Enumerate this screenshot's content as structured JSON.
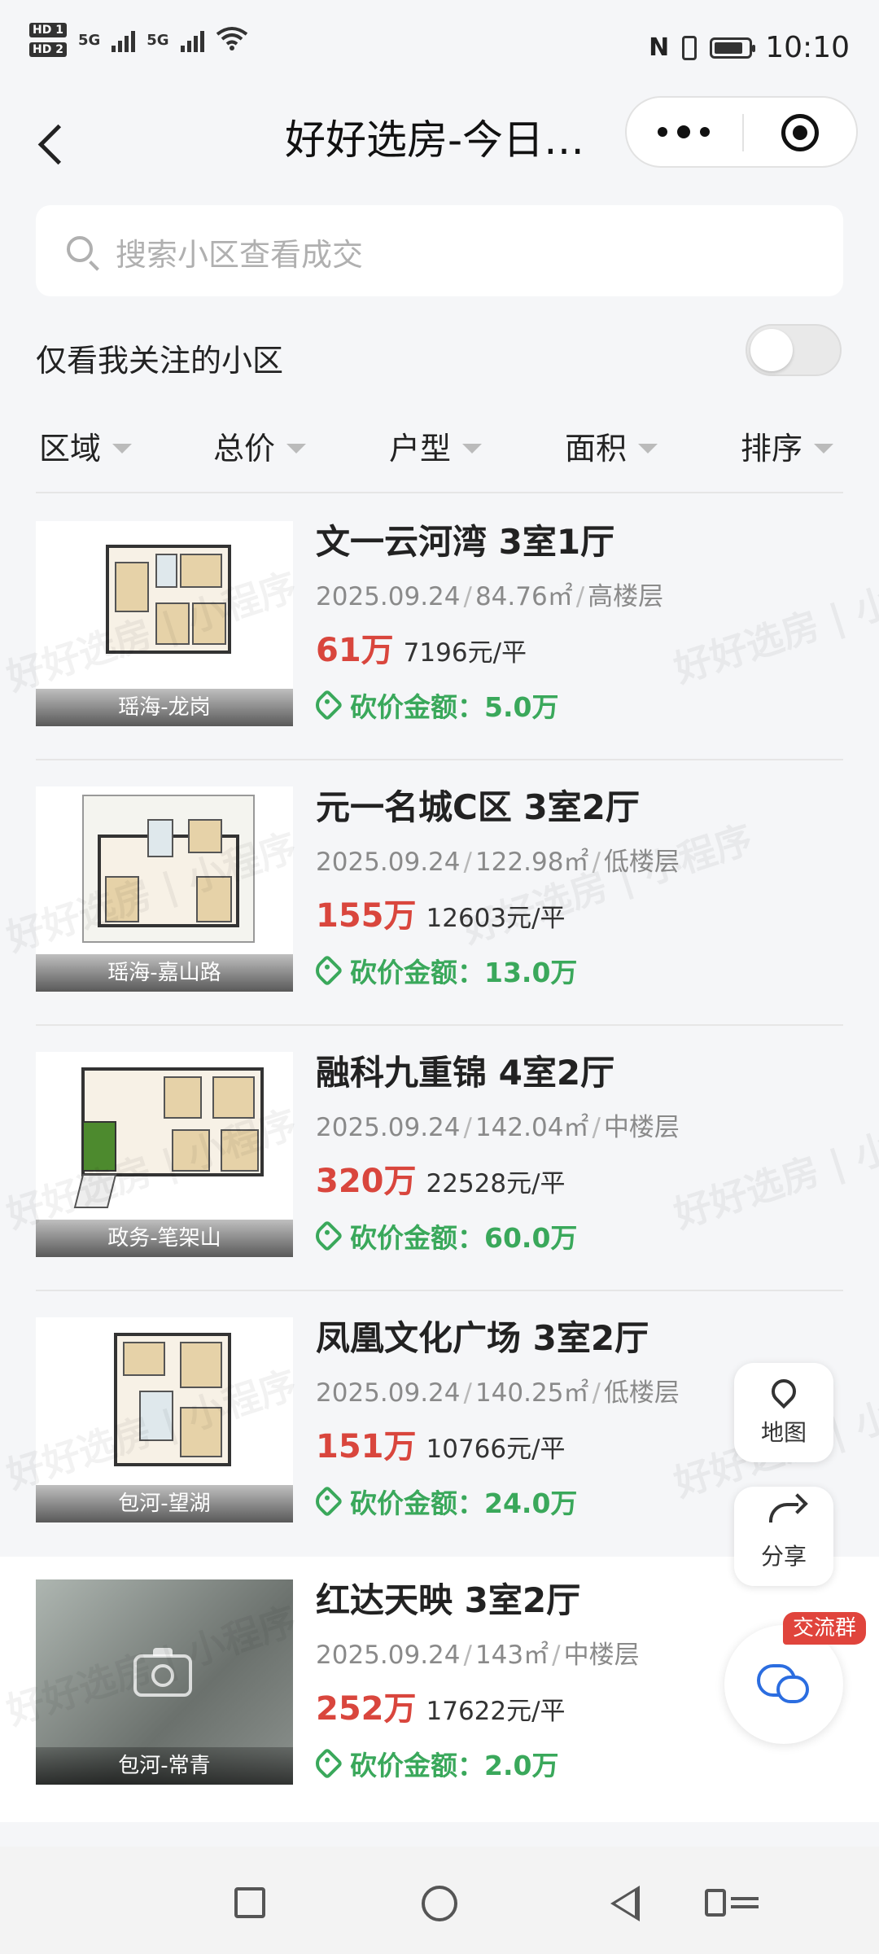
{
  "status_bar": {
    "sim1": "HD 1",
    "sim2": "HD 2",
    "net1": "5G",
    "net2": "5G",
    "wifi": "6",
    "time": "10:10"
  },
  "nav": {
    "title": "好好选房-今日…",
    "back_icon": "chevron-left-icon",
    "more_icon": "more-dots-icon",
    "close_icon": "target-circle-icon"
  },
  "search": {
    "placeholder": "搜索小区查看成交"
  },
  "follow_toggle": {
    "label": "仅看我关注的小区",
    "on": false
  },
  "filters": [
    {
      "label": "区域"
    },
    {
      "label": "总价"
    },
    {
      "label": "户型"
    },
    {
      "label": "面积"
    },
    {
      "label": "排序"
    }
  ],
  "listings": [
    {
      "title": "文一云河湾 3室1厅",
      "date": "2025.09.24",
      "area": "84.76㎡",
      "floor": "高楼层",
      "price": "61万",
      "unit_price": "7196元/平",
      "cut": "砍价金额：5.0万",
      "location": "瑶海-龙岗"
    },
    {
      "title": "元一名城C区 3室2厅",
      "date": "2025.09.24",
      "area": "122.98㎡",
      "floor": "低楼层",
      "price": "155万",
      "unit_price": "12603元/平",
      "cut": "砍价金额：13.0万",
      "location": "瑶海-嘉山路"
    },
    {
      "title": "融科九重锦 4室2厅",
      "date": "2025.09.24",
      "area": "142.04㎡",
      "floor": "中楼层",
      "price": "320万",
      "unit_price": "22528元/平",
      "cut": "砍价金额：60.0万",
      "location": "政务-笔架山"
    },
    {
      "title": "凤凰文化广场 3室2厅",
      "date": "2025.09.24",
      "area": "140.25㎡",
      "floor": "低楼层",
      "price": "151万",
      "unit_price": "10766元/平",
      "cut": "砍价金额：24.0万",
      "location": "包河-望湖"
    },
    {
      "title": "红达天映 3室2厅",
      "date": "2025.09.24",
      "area": "143㎡",
      "floor": "中楼层",
      "price": "252万",
      "unit_price": "17622元/平",
      "cut": "砍价金额：2.0万",
      "location": "包河-常青"
    }
  ],
  "watermark": {
    "text": "好好选房 | 小程序"
  },
  "floating": {
    "map_label": "地图",
    "share_label": "分享",
    "group_badge": "交流群"
  },
  "colors": {
    "price_red": "#d9463d",
    "cut_green": "#3aa85b",
    "badge_red": "#e0443c",
    "chat_blue": "#2b6de0"
  }
}
